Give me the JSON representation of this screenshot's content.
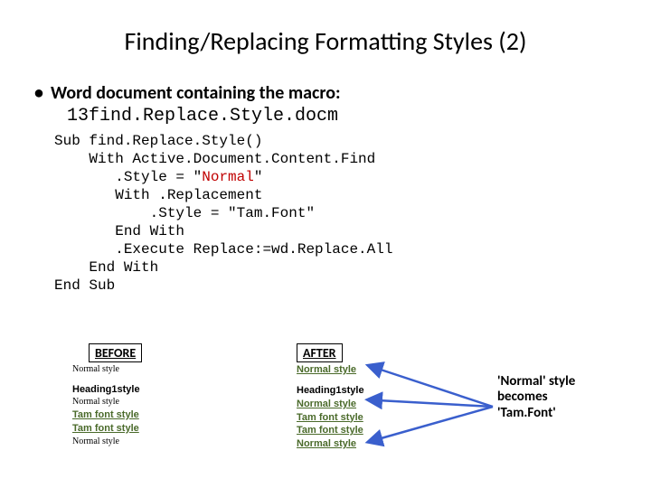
{
  "title": "Finding/Replacing Formatting Styles (2)",
  "bullet": "Word document containing the macro:",
  "filename": "13find.Replace.Style.docm",
  "code": {
    "l1": "Sub find.Replace.Style()",
    "l2": "    With Active.Document.Content.Find",
    "l3a": "       .Style = \"",
    "l3b": "Normal",
    "l3c": "\"",
    "l4": "       With .Replacement",
    "l5": "           .Style = \"Tam.Font\"",
    "l6": "       End With",
    "l7": "       .Execute Replace:=wd.Replace.All",
    "l8": "    End With",
    "l9": "End Sub"
  },
  "before": {
    "label": "BEFORE",
    "r1": "Normal style",
    "r2": "Heading1style",
    "r3": "Normal style",
    "r4": "Tam font style",
    "r5": "Tam font style",
    "r6": "Normal style"
  },
  "after": {
    "label": "AFTER",
    "r1": "Normal style",
    "r2": "Heading1style",
    "r3": "Normal style",
    "r4": "Tam font style",
    "r5": "Tam font style",
    "r6": "Normal style"
  },
  "note": "'Normal' style becomes 'Tam.Font'"
}
